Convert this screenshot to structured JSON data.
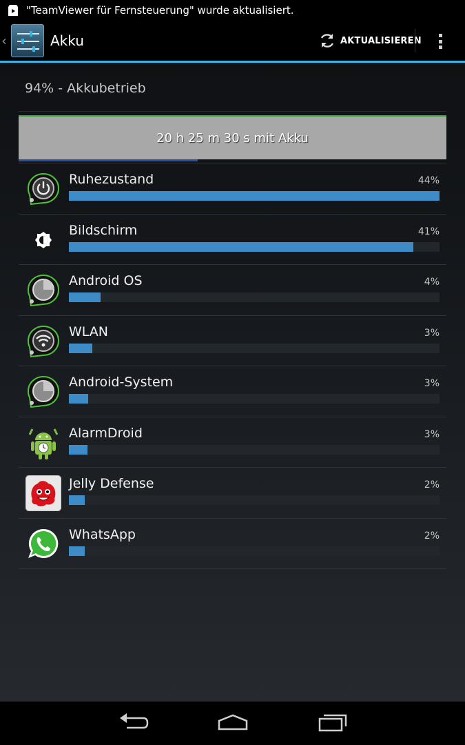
{
  "status_bar": {
    "notification_text": "\"TeamViewer für Fernsteuerung\" wurde aktualisiert.",
    "icon": "play-store-icon"
  },
  "action_bar": {
    "title": "Akku",
    "icon": "settings-icon",
    "refresh_label": "AKTUALISIEREN",
    "refresh_icon": "refresh-icon",
    "overflow_icon": "overflow-menu-icon",
    "accent_color": "#33b5e5"
  },
  "battery": {
    "summary": "94% - Akkubetrieb",
    "graph_label": "20 h 25 m 30 s mit Akku"
  },
  "usage": [
    {
      "label": "Ruhezustand",
      "percent_label": "44%",
      "percent": 100,
      "icon": "power-icon"
    },
    {
      "label": "Bildschirm",
      "percent_label": "41%",
      "percent": 93,
      "icon": "brightness-icon"
    },
    {
      "label": "Android OS",
      "percent_label": "4%",
      "percent": 8.5,
      "icon": "android-os-icon"
    },
    {
      "label": "WLAN",
      "percent_label": "3%",
      "percent": 6.3,
      "icon": "wifi-icon"
    },
    {
      "label": "Android-System",
      "percent_label": "3%",
      "percent": 5.2,
      "icon": "android-system-icon"
    },
    {
      "label": "AlarmDroid",
      "percent_label": "3%",
      "percent": 5.0,
      "icon": "alarmdroid-icon"
    },
    {
      "label": "Jelly Defense",
      "percent_label": "2%",
      "percent": 4.2,
      "icon": "jelly-defense-icon"
    },
    {
      "label": "WhatsApp",
      "percent_label": "2%",
      "percent": 4.2,
      "icon": "whatsapp-icon"
    }
  ],
  "nav_bar": {
    "back_icon": "back-icon",
    "home_icon": "home-icon",
    "recents_icon": "recent-apps-icon"
  }
}
